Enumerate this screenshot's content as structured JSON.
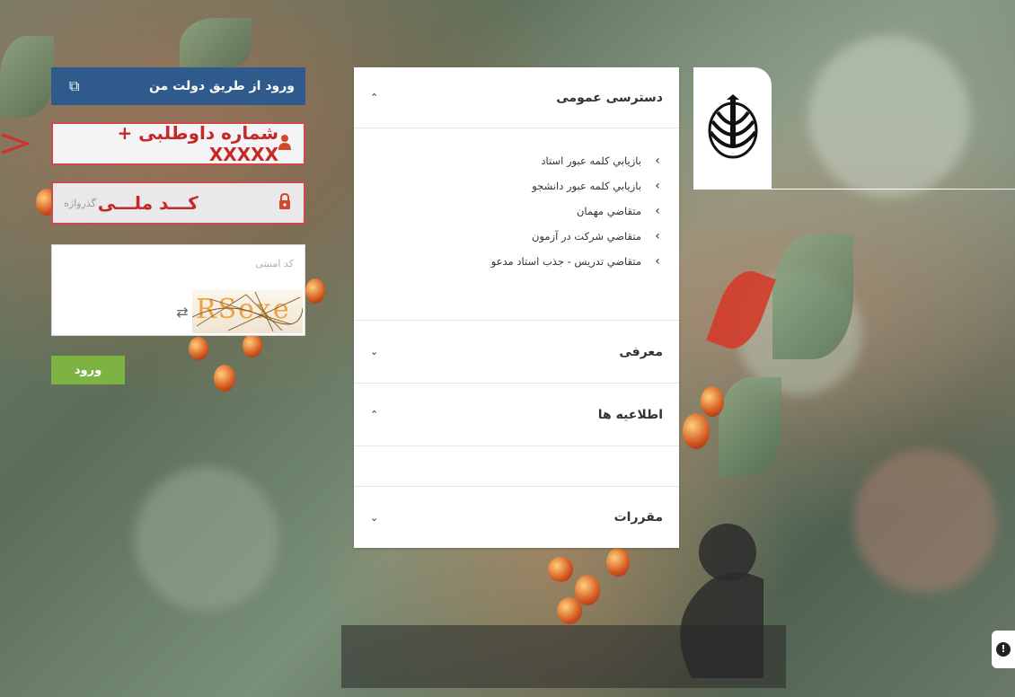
{
  "gov_login": {
    "label": "ورود از طریق دولت من",
    "icon": "external-link-icon"
  },
  "username": {
    "value": "شماره داوطلبی + XXXXX",
    "icon": "user-icon"
  },
  "password": {
    "value": "کـــد ملـــی",
    "placeholder": "گذرواژه",
    "icon": "lock-icon"
  },
  "captcha": {
    "placeholder": "کد امنیتی",
    "image_text": "RSexe",
    "refresh_icon": "refresh-icon"
  },
  "submit_label": "ورود",
  "public_access": {
    "title": "دسترسی عمومی",
    "links": [
      "بازيابي كلمه عبور استاد",
      "بازيابي كلمه عبور دانشجو",
      "متقاضي مهمان",
      "متقاضي شركت در آزمون",
      "متقاضي تدريس - جذب استاد مدعو"
    ]
  },
  "intro": {
    "title": "معرفی"
  },
  "announcements": {
    "title": "اطلاعیه ها"
  },
  "regulations": {
    "title": "مقررات"
  },
  "colors": {
    "accent": "#2f5b8c",
    "submit": "#7cb342",
    "highlight": "#c62828"
  }
}
